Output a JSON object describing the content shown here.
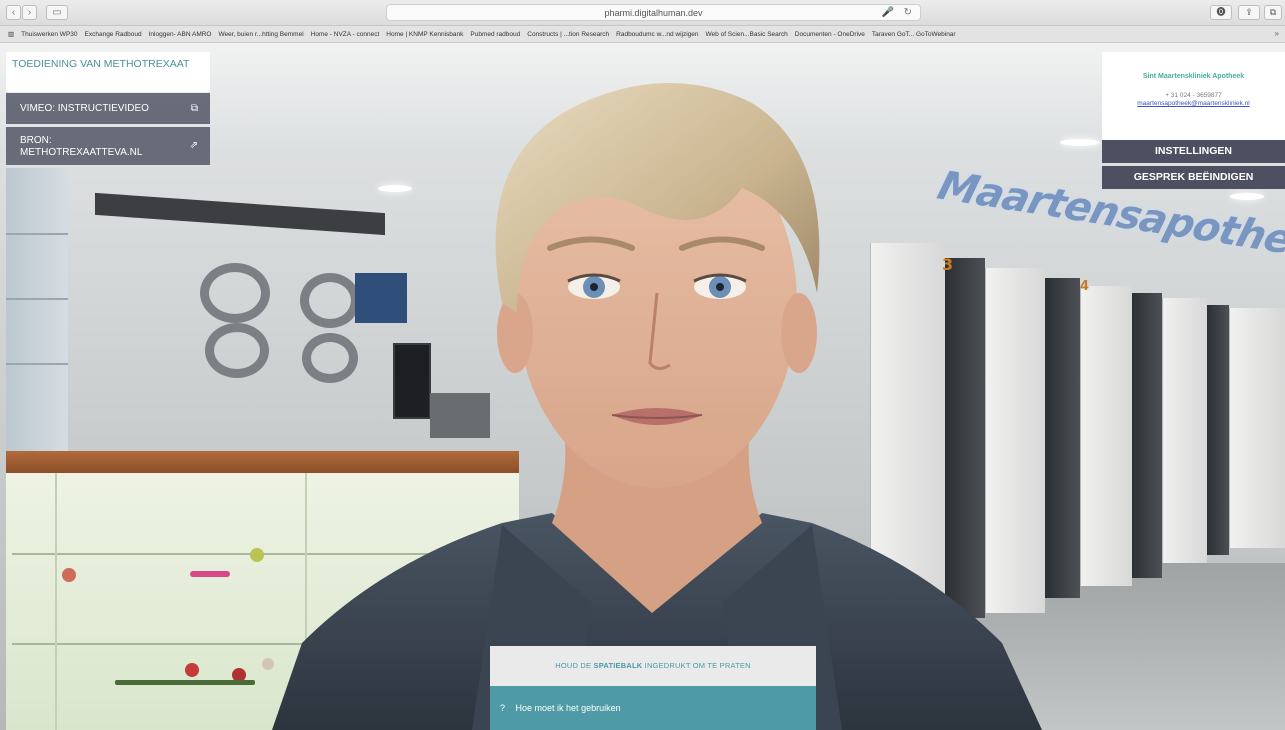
{
  "browser": {
    "address": "pharmi.digitalhuman.dev",
    "nav": {
      "back": "‹",
      "forward": "›",
      "sidebar": "▭"
    },
    "icons": {
      "mic": "🎤",
      "reload": "↻",
      "shield": "⓿",
      "share": "⇪",
      "tabs": "⧉"
    },
    "bookmarks": [
      "Thuiswerken WP30",
      "Exchange Radboud",
      "Inloggen- ABN AMRO",
      "Weer, buien r...htting Bemmel",
      "Home - NVZA - connect",
      "Home | KNMP Kennisbank",
      "Pubmed radboud",
      "Constructs | ...tion Research",
      "Radboudumc w...nd wijzigen",
      "Web of Scien...Basic Search",
      "Documenten - OneDrive",
      "Taraven GoT... GoToWebinar"
    ],
    "bookmarks_more": "»"
  },
  "panel": {
    "title": "TOEDIENING VAN METHOTREXAAT",
    "links": [
      {
        "label": "VIMEO: INSTRUCTIEVIDEO",
        "icon": "external-video-icon",
        "glyph": "⧉"
      },
      {
        "label": "BRON: METHOTREXAATTEVA.NL",
        "icon": "external-link-icon",
        "glyph": "⇗"
      }
    ]
  },
  "contact": {
    "name": "Sint Maartenskliniek Apotheek",
    "phone": "+ 31 024 - 3659877",
    "email": "maartensapotheek@maartenskliniek.nl"
  },
  "buttons": {
    "settings": "INSTELLINGEN",
    "end_conversation": "GESPREK BEËINDIGEN"
  },
  "scene": {
    "store_sign": "Maartensapotheek",
    "counter_numbers": [
      "3",
      "4"
    ]
  },
  "prompt": {
    "hint_before": "HOUD DE",
    "hint_key": "SPATIEBALK",
    "hint_after": "INGEDRUKT OM TE PRATEN",
    "question_icon": "?",
    "question": "Hoe moet ik het gebruiken"
  },
  "colors": {
    "accent": "#4e9aa6",
    "panel": "#5f6270",
    "brand_green": "#45b09a"
  }
}
